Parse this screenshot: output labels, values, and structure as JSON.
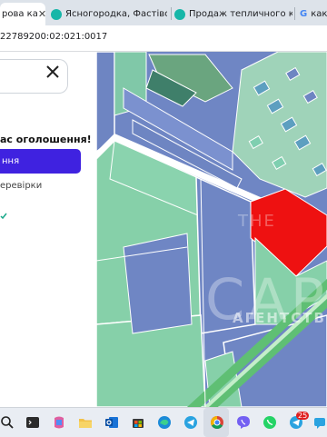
{
  "browser": {
    "tabs": [
      {
        "label": "рова ка",
        "active": true
      },
      {
        "label": "Ясногородка, Фастівськ",
        "active": false
      },
      {
        "label": "Продаж тепличного ко",
        "active": false
      },
      {
        "label": "как",
        "active": false
      }
    ],
    "address": "22789200:02:021:0017"
  },
  "panel": {
    "question": "ас оголошення!",
    "button_label": "ння",
    "check_label": "еревірки"
  },
  "map": {
    "watermark_top": "THE",
    "watermark_main": "CAPITAL",
    "watermark_sub": "АГЕНТСТВО НЕРУХОМОСТІ",
    "highlight_color": "#ee1111"
  },
  "taskbar": {
    "icons": [
      "search-icon",
      "terminal-icon",
      "copilot-icon",
      "file-explorer-icon",
      "outlook-icon",
      "store-icon",
      "edge-icon",
      "telegram-icon",
      "chrome-icon",
      "viber-icon",
      "whatsapp-icon",
      "telegram-icon-2"
    ],
    "badge": "25"
  }
}
